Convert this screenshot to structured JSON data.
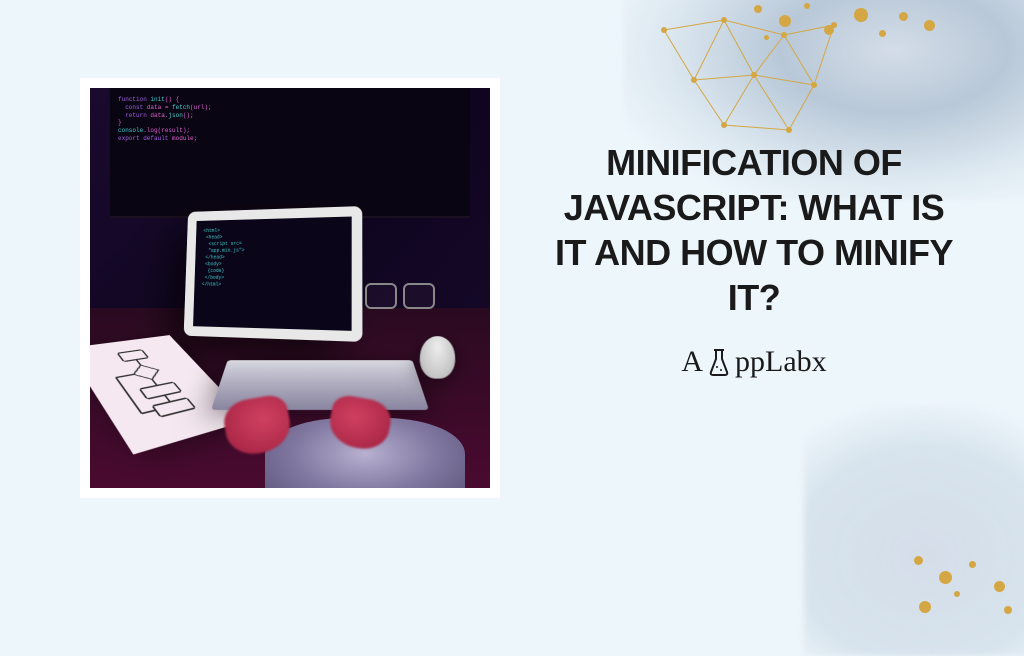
{
  "title": "MINIFICATION OF JAVASCRIPT: WHAT IS IT AND HOW TO MINIFY IT?",
  "brand": {
    "prefix": "A",
    "suffix": "ppLabx"
  },
  "colors": {
    "background": "#edf6fb",
    "text": "#1a1a1a",
    "gold": "#d4a744"
  }
}
